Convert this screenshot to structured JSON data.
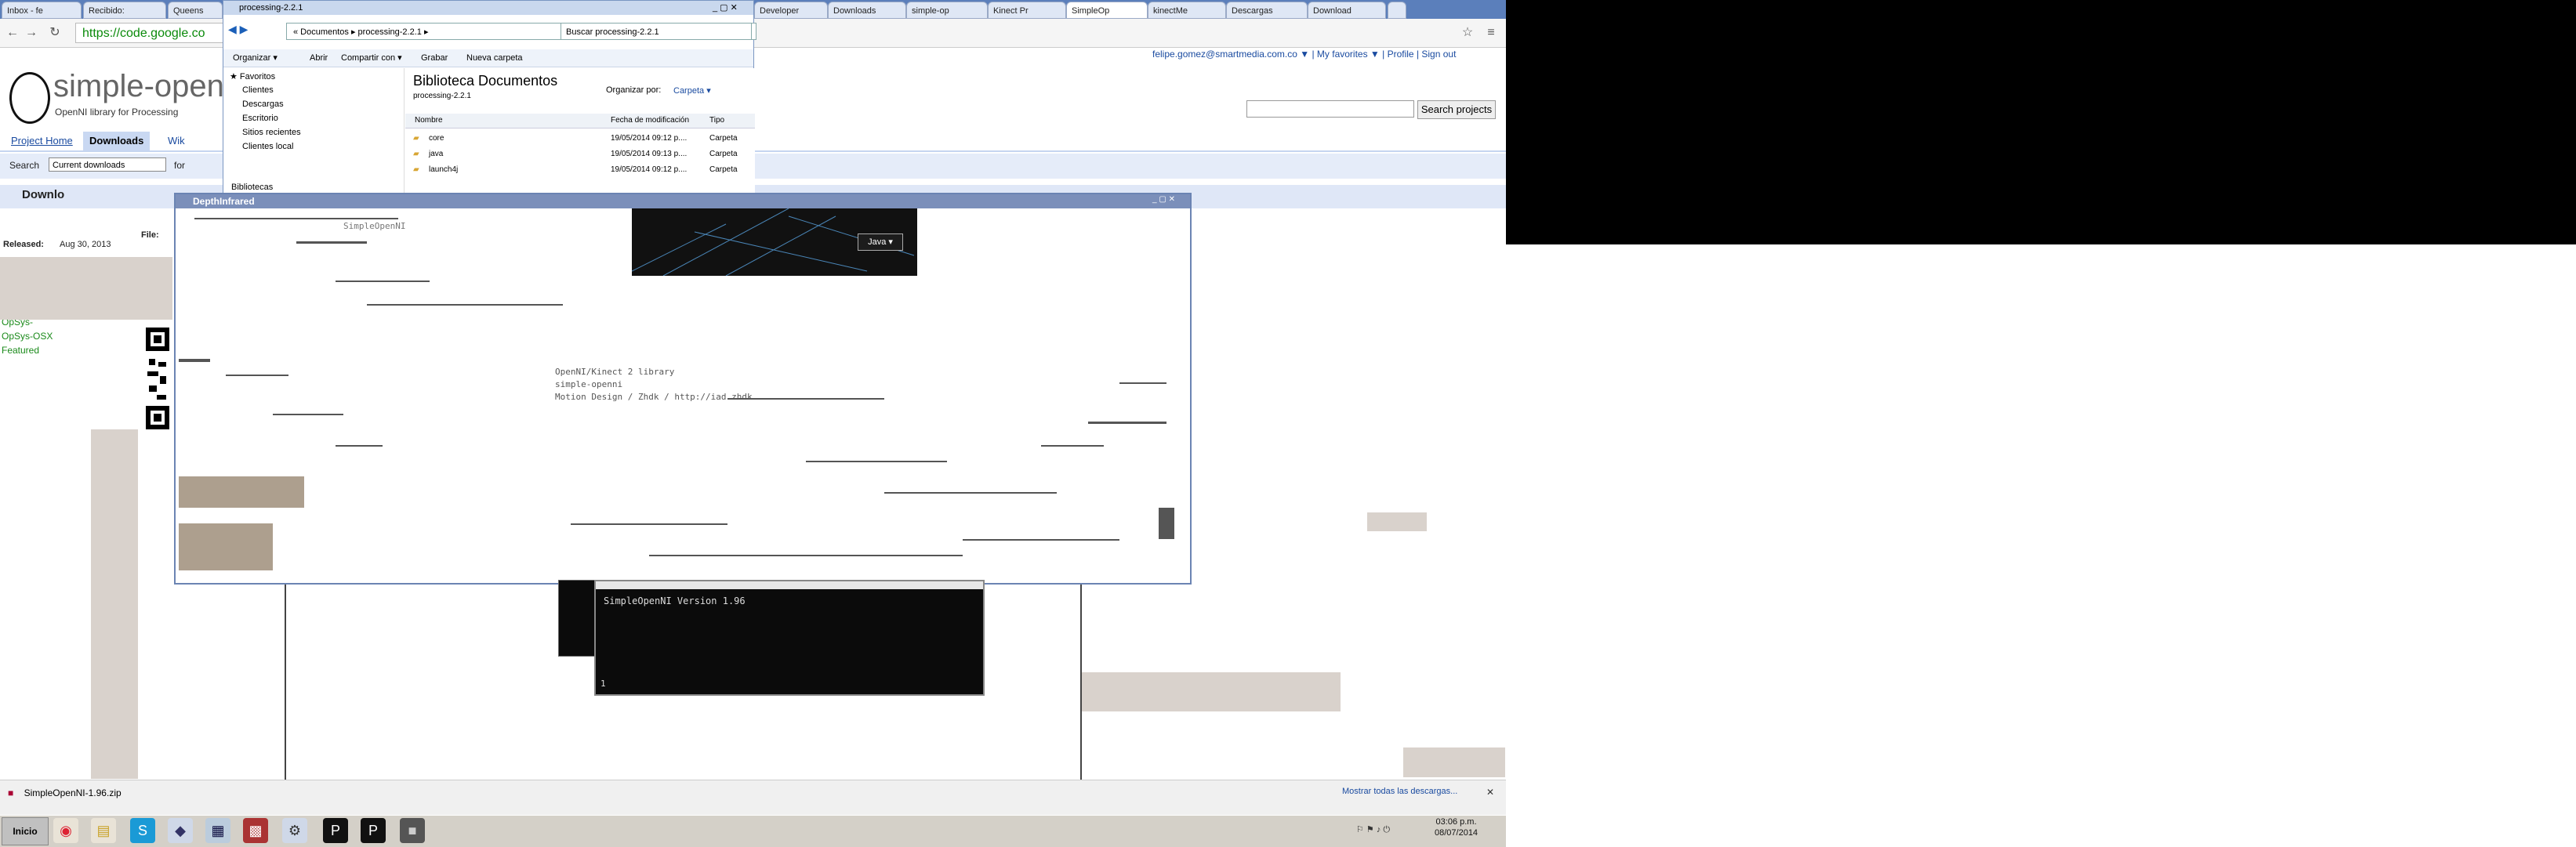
{
  "tabs": [
    {
      "label": "Inbox - fe"
    },
    {
      "label": "Recibido:"
    },
    {
      "label": "Queens"
    },
    {
      "label": "Developer"
    },
    {
      "label": "Downloads"
    },
    {
      "label": "simple-op"
    },
    {
      "label": "Kinect Pr"
    },
    {
      "label": "SimpleOp"
    },
    {
      "label": "kinectMe"
    },
    {
      "label": "Descargas"
    },
    {
      "label": "Download"
    }
  ],
  "toolbar": {
    "url": "https://code.google.co",
    "back_icon": "back-arrow-icon",
    "forward_icon": "forward-arrow-icon",
    "reload_icon": "reload-icon",
    "star_icon": "star-icon",
    "menu_icon": "menu-icon"
  },
  "site": {
    "title": "simple-open",
    "subtitle": "OpenNI library for Processing",
    "user_links": "felipe.gomez@smartmedia.com.co ▼ | My favorites ▼ | Profile | Sign out",
    "search_button": "Search projects"
  },
  "nav": {
    "project_home": "Project Home",
    "downloads": "Downloads",
    "wiki": "Wik"
  },
  "searchrow": {
    "label": "Search",
    "select_value": "Current downloads",
    "for_label": "for"
  },
  "downloads_heading": "Downlo",
  "released_label": "Released:",
  "released_value": "Aug 30, 2013",
  "file_label": "File:",
  "opsys_osx": "OpSys-OSX",
  "opsys_other": "OpSys-",
  "featured": "Featured",
  "explorer": {
    "title": "processing-2.2.1",
    "address": "« Documentos ▸ processing-2.2.1 ▸",
    "search_placeholder": "Buscar processing-2.2.1",
    "cmd": [
      "Organizar ▾",
      "Abrir",
      "Compartir con ▾",
      "Grabar",
      "Nueva carpeta"
    ],
    "nav_items": [
      "Favoritos",
      "Clientes",
      "Descargas",
      "Escritorio",
      "Sitios recientes",
      "Clientes local",
      "Bibliotecas"
    ],
    "library_title": "Biblioteca Documentos",
    "library_sub": "processing-2.2.1",
    "arrange_label": "Organizar por:",
    "arrange_value": "Carpeta ▾",
    "col_name": "Nombre",
    "col_date": "Fecha de modificación",
    "col_type": "Tipo",
    "rows": [
      {
        "name": "core",
        "date": "19/05/2014 09:12 p....",
        "type": "Carpeta"
      },
      {
        "name": "java",
        "date": "19/05/2014 09:13 p....",
        "type": "Carpeta"
      },
      {
        "name": "launch4j",
        "date": "19/05/2014 09:12 p....",
        "type": "Carpeta"
      }
    ]
  },
  "depth": {
    "title": "DepthInfrared",
    "java_button": "Java ▾",
    "overlay_line1": "OpenNI/Kinect 2 library",
    "overlay_line2": "simple-openni",
    "overlay_line3": "Motion Design / Zhdk / http://iad.zhdk",
    "ghost_text": "SimpleOpenNI"
  },
  "console": {
    "text": "SimpleOpenNI Version 1.96",
    "status": "1"
  },
  "download_shelf": {
    "file": "SimpleOpenNI-1.96.zip",
    "show_all": "Mostrar todas las descargas..."
  },
  "taskbar": {
    "start": "Inicio",
    "clock_time": "03:06 p.m.",
    "clock_date": "08/07/2014",
    "icons": [
      "chrome-icon",
      "folder-icon",
      "skype-icon",
      "app-icon",
      "network-icon",
      "winrar-icon",
      "tools-icon",
      "processing-icon",
      "processing-icon-2",
      "window-icon"
    ]
  }
}
